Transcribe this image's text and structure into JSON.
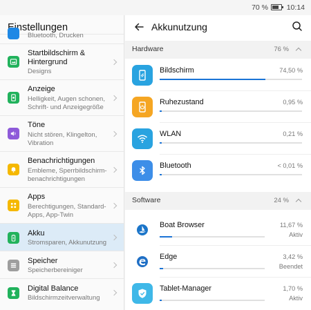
{
  "status": {
    "battery_text": "70 %",
    "time": "10:14"
  },
  "settings": {
    "title": "Einstellungen",
    "items": [
      {
        "name": "",
        "sub": "Bluetooth, Drucken",
        "icon": "bluetooth-icon",
        "color": "#1e88e5"
      },
      {
        "name": "Startbildschirm & Hintergrund",
        "sub": "Designs",
        "icon": "home-screen-icon",
        "color": "#21b25c"
      },
      {
        "name": "Anzeige",
        "sub": "Helligkeit, Augen schonen, Schrift- und Anzeigegröße",
        "icon": "display-icon",
        "color": "#21b25c"
      },
      {
        "name": "Töne",
        "sub": "Nicht stören, Klingelton, Vibration",
        "icon": "sound-icon",
        "color": "#8e5ad9"
      },
      {
        "name": "Benachrichtigungen",
        "sub": "Embleme, Sperrbildschirm-benachrichtigungen",
        "icon": "notification-icon",
        "color": "#f5b800"
      },
      {
        "name": "Apps",
        "sub": "Berechtigungen, Standard-Apps, App-Twin",
        "icon": "apps-icon",
        "color": "#f5b800"
      },
      {
        "name": "Akku",
        "sub": "Stromsparen, Akkunutzung",
        "icon": "battery-icon",
        "color": "#21b25c"
      },
      {
        "name": "Speicher",
        "sub": "Speicherbereiniger",
        "icon": "storage-icon",
        "color": "#9e9e9e"
      },
      {
        "name": "Digital Balance",
        "sub": "Bildschirmzeitverwaltung",
        "icon": "hourglass-icon",
        "color": "#21b25c"
      }
    ]
  },
  "usage": {
    "title": "Akkunutzung",
    "hardware": {
      "label": "Hardware",
      "percent": "76 %",
      "items": [
        {
          "name": "Bildschirm",
          "percent": "74,50 %",
          "value": 0.745,
          "icon": "screen-icon",
          "color": "#29a3e0"
        },
        {
          "name": "Ruhezustand",
          "percent": "0,95 %",
          "value": 0.0095,
          "icon": "standby-icon",
          "color": "#f5a623"
        },
        {
          "name": "WLAN",
          "percent": "0,21 %",
          "value": 0.0021,
          "icon": "wifi-icon",
          "color": "#29a3e0"
        },
        {
          "name": "Bluetooth",
          "percent": "< 0,01 %",
          "value": 0.0001,
          "icon": "bluetooth-icon",
          "color": "#3d8ee8"
        }
      ]
    },
    "software": {
      "label": "Software",
      "percent": "24 %",
      "items": [
        {
          "name": "Boat Browser",
          "percent": "11,67 %",
          "state": "Aktiv",
          "value": 0.1167,
          "icon": "boat-browser-icon",
          "color": "#1b75c9"
        },
        {
          "name": "Edge",
          "percent": "3,42 %",
          "state": "Beendet",
          "value": 0.0342,
          "icon": "edge-icon",
          "color": "#1f6fc5"
        },
        {
          "name": "Tablet-Manager",
          "percent": "1,70 %",
          "state": "Aktiv",
          "value": 0.017,
          "icon": "shield-icon",
          "color": "#3fb8e8"
        }
      ]
    }
  }
}
